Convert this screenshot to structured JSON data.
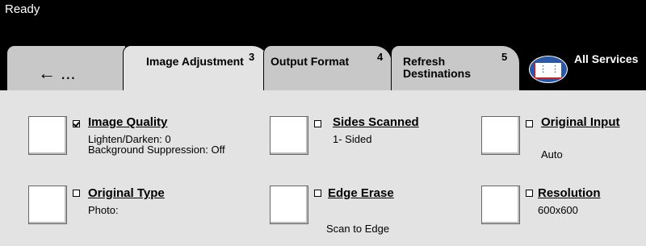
{
  "status": {
    "text": "Ready"
  },
  "tabs": {
    "back": {
      "label": "← ..."
    },
    "image_adjustment": {
      "label": "Image Adjustment",
      "num": "3"
    },
    "output_format": {
      "label": "Output Format",
      "num": "4"
    },
    "refresh": {
      "label_line1": "Refresh",
      "label_line2": "Destinations",
      "num": "5"
    },
    "all_services": {
      "label": "All Services"
    }
  },
  "features": {
    "image_quality": {
      "title": "Image Quality",
      "value1": "Lighten/Darken: 0",
      "value2": "Background Suppression: Off",
      "checked": true
    },
    "sides_scanned": {
      "title": "Sides Scanned",
      "value1": "1- Sided",
      "checked": false
    },
    "original_input": {
      "title": "Original Input",
      "value1": "Auto",
      "checked": false
    },
    "original_type": {
      "title": "Original Type",
      "value1": "Photo:",
      "checked": false
    },
    "edge_erase": {
      "title": "Edge Erase",
      "value1": "Scan to Edge",
      "checked": false
    },
    "resolution": {
      "title": "Resolution",
      "value1": "600x600",
      "checked": false
    }
  }
}
